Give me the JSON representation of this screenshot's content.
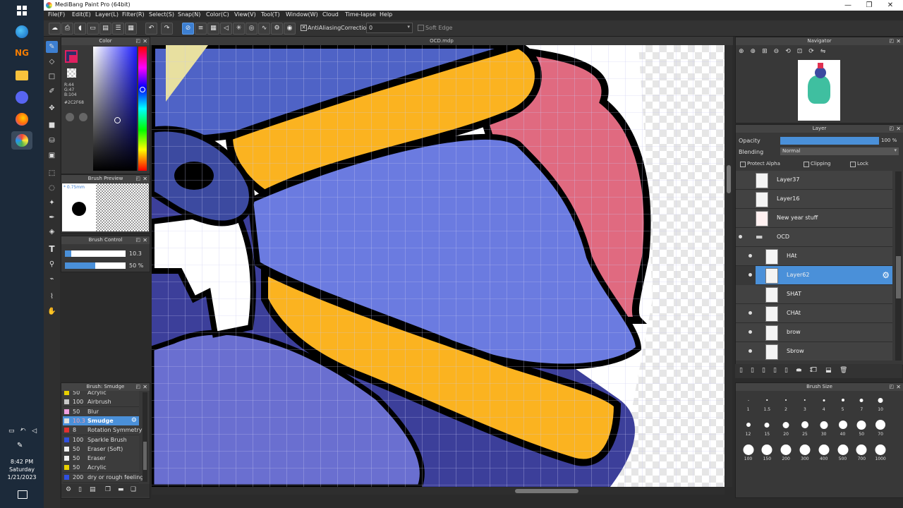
{
  "taskbar": {
    "time": "8:42 PM",
    "day": "Saturday",
    "date": "1/21/2023"
  },
  "title": "MediBang Paint Pro (64bit)",
  "menu": [
    "File(F)",
    "Edit(E)",
    "Layer(L)",
    "Filter(R)",
    "Select(S)",
    "Snap(N)",
    "Color(C)",
    "View(V)",
    "Tool(T)",
    "Window(W)",
    "Cloud",
    "Time-lapse",
    "Help"
  ],
  "toolbar": {
    "antialiasing_label": "AntiAliasing",
    "correction_label": "Correction",
    "correction_value": "0",
    "soft_edge_label": "Soft Edge"
  },
  "color_panel": {
    "title": "Color",
    "r": "R:44",
    "g": "G:47",
    "b": "B:104",
    "hex": "#2C2F68",
    "fg_color": "#2c2f68"
  },
  "brush_preview": {
    "title": "Brush Preview",
    "size": "* 0.75mm"
  },
  "brush_control": {
    "title": "Brush Control",
    "size_value": "10.3",
    "opacity_value": "50 %",
    "size_fraction": 0.1,
    "opacity_fraction": 0.5
  },
  "brush_list": {
    "title": "Brush: Smudge",
    "items": [
      {
        "size": "50",
        "name": "Acrylic",
        "color": "#e8d000"
      },
      {
        "size": "100",
        "name": "Airbrush",
        "color": "#c8c8c8"
      },
      {
        "size": "50",
        "name": "Blur",
        "color": "#f0a0e0"
      },
      {
        "size": "10.3",
        "name": "Smudge",
        "color": "#e0e0e0"
      },
      {
        "size": "8",
        "name": "Rotation Symmetry",
        "color": "#e03030"
      },
      {
        "size": "100",
        "name": "Sparkle Brush",
        "color": "#3050e0"
      },
      {
        "size": "50",
        "name": "Eraser (Soft)",
        "color": "#f0f0f0"
      },
      {
        "size": "50",
        "name": "Eraser",
        "color": "#f0f0f0"
      },
      {
        "size": "50",
        "name": "Acrylic",
        "color": "#e8d000"
      },
      {
        "size": "200",
        "name": "dry or rough feeling",
        "color": "#3050e0"
      }
    ]
  },
  "canvas": {
    "filename": "OCD.mdp"
  },
  "navigator": {
    "title": "Navigator"
  },
  "layer_panel": {
    "title": "Layer",
    "opacity_label": "Opacity",
    "opacity_value": "100 %",
    "opacity_fraction": 1.0,
    "blending_label": "Blending",
    "blending_value": "Normal",
    "protect_alpha": "Protect Alpha",
    "clipping": "Clipping",
    "lock": "Lock",
    "layers": [
      {
        "name": "Layer37"
      },
      {
        "name": "Layer16"
      },
      {
        "name": "New year stuff"
      },
      {
        "name": "OCD"
      },
      {
        "name": "HAt"
      },
      {
        "name": "Layer62"
      },
      {
        "name": "SHAT"
      },
      {
        "name": "CHAt"
      },
      {
        "name": "brow"
      },
      {
        "name": "Sbrow"
      }
    ]
  },
  "brush_size": {
    "title": "Brush Size",
    "row1": [
      "1",
      "1.5",
      "2",
      "3",
      "4",
      "5",
      "7",
      "10"
    ],
    "row2": [
      "12",
      "15",
      "20",
      "25",
      "30",
      "40",
      "50",
      "70"
    ],
    "row3": [
      "100",
      "150",
      "200",
      "300",
      "400",
      "500",
      "700",
      "1000"
    ]
  }
}
